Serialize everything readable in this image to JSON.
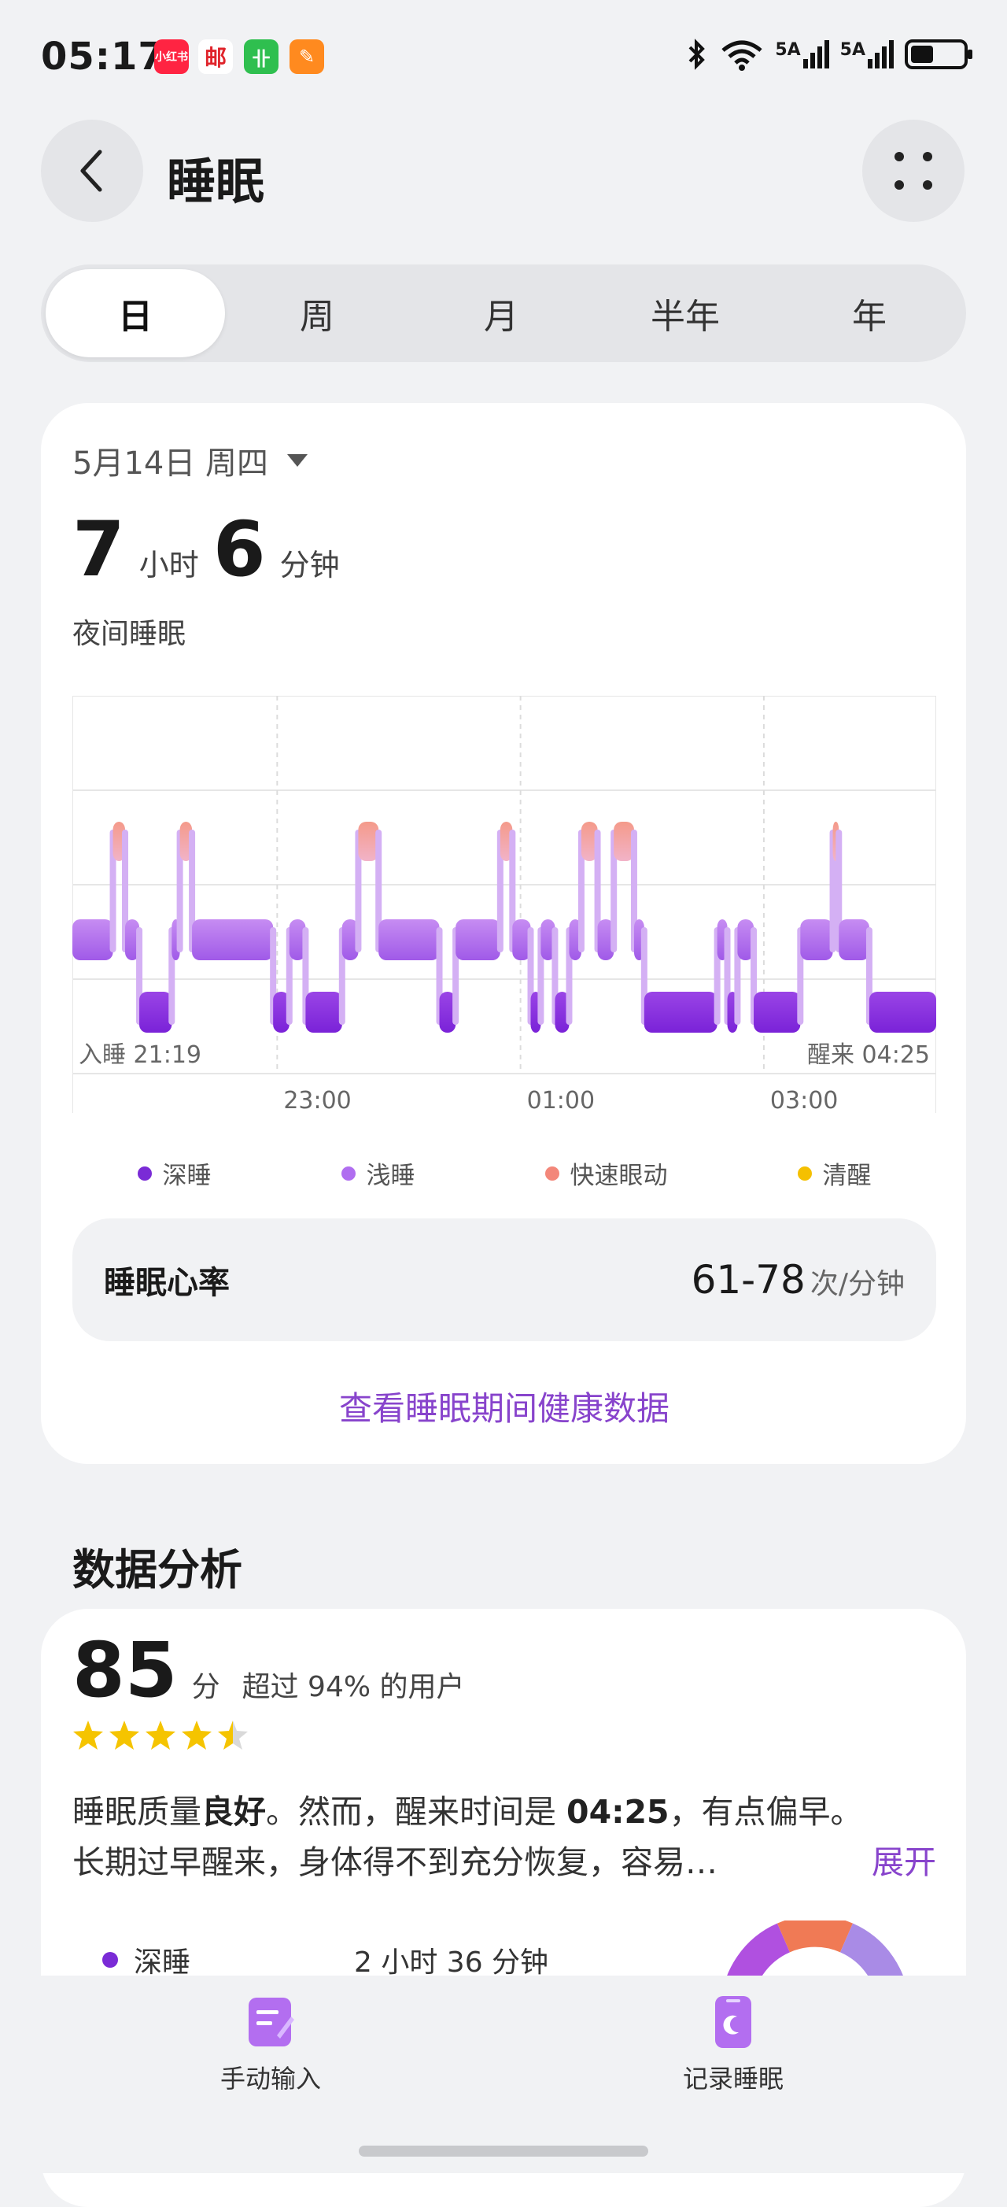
{
  "status": {
    "time": "05:17",
    "apps": [
      {
        "name": "xiaohongshu-icon",
        "label": "小红书",
        "color": "#ff2442"
      },
      {
        "name": "post-icon",
        "label": "邮",
        "color": "#ffffff"
      },
      {
        "name": "green-app-icon",
        "label": "卝",
        "color": "#2fbf4f"
      },
      {
        "name": "orange-app-icon",
        "label": "✎",
        "color": "#ff8a1f"
      }
    ],
    "net1": "5A",
    "net2": "5A"
  },
  "header": {
    "title": "睡眠"
  },
  "tabs": [
    {
      "label": "日"
    },
    {
      "label": "周"
    },
    {
      "label": "月"
    },
    {
      "label": "半年"
    },
    {
      "label": "年"
    }
  ],
  "summary": {
    "date": "5月14日 周四",
    "hours": "7",
    "hours_unit": "小时",
    "minutes": "6",
    "minutes_unit": "分钟",
    "subtitle": "夜间睡眠"
  },
  "chart_data": {
    "type": "area",
    "sleep_start_label": "入睡 21:19",
    "wake_label": "醒来 04:25",
    "x_ticks": [
      "23:00",
      "01:00",
      "03:00"
    ],
    "stages": [
      "深睡",
      "浅睡",
      "快速眼动",
      "清醒"
    ],
    "colors": {
      "deep": "#8a2be2",
      "light": "#b06ef0",
      "rem": "#f3877a",
      "awake": "#f5c000"
    },
    "segments": [
      {
        "start": "21:19",
        "end": "21:39",
        "stage": "light"
      },
      {
        "start": "21:39",
        "end": "21:45",
        "stage": "rem"
      },
      {
        "start": "21:45",
        "end": "21:52",
        "stage": "light"
      },
      {
        "start": "21:52",
        "end": "22:08",
        "stage": "deep"
      },
      {
        "start": "22:08",
        "end": "22:12",
        "stage": "light"
      },
      {
        "start": "22:12",
        "end": "22:18",
        "stage": "rem"
      },
      {
        "start": "22:18",
        "end": "22:58",
        "stage": "light"
      },
      {
        "start": "22:58",
        "end": "23:06",
        "stage": "deep"
      },
      {
        "start": "23:06",
        "end": "23:14",
        "stage": "light"
      },
      {
        "start": "23:14",
        "end": "23:32",
        "stage": "deep"
      },
      {
        "start": "23:32",
        "end": "23:40",
        "stage": "light"
      },
      {
        "start": "23:40",
        "end": "23:50",
        "stage": "rem"
      },
      {
        "start": "23:50",
        "end": "00:20",
        "stage": "light"
      },
      {
        "start": "00:20",
        "end": "00:28",
        "stage": "deep"
      },
      {
        "start": "00:28",
        "end": "00:50",
        "stage": "light"
      },
      {
        "start": "00:50",
        "end": "00:56",
        "stage": "rem"
      },
      {
        "start": "00:56",
        "end": "01:05",
        "stage": "light"
      },
      {
        "start": "01:05",
        "end": "01:10",
        "stage": "deep"
      },
      {
        "start": "01:10",
        "end": "01:17",
        "stage": "light"
      },
      {
        "start": "01:17",
        "end": "01:24",
        "stage": "deep"
      },
      {
        "start": "01:24",
        "end": "01:30",
        "stage": "light"
      },
      {
        "start": "01:30",
        "end": "01:38",
        "stage": "rem"
      },
      {
        "start": "01:38",
        "end": "01:46",
        "stage": "light"
      },
      {
        "start": "01:46",
        "end": "01:56",
        "stage": "rem"
      },
      {
        "start": "01:56",
        "end": "02:01",
        "stage": "light"
      },
      {
        "start": "02:01",
        "end": "02:37",
        "stage": "deep"
      },
      {
        "start": "02:37",
        "end": "02:42",
        "stage": "light"
      },
      {
        "start": "02:42",
        "end": "02:47",
        "stage": "deep"
      },
      {
        "start": "02:47",
        "end": "02:55",
        "stage": "light"
      },
      {
        "start": "02:55",
        "end": "03:18",
        "stage": "deep"
      },
      {
        "start": "03:18",
        "end": "03:34",
        "stage": "light"
      },
      {
        "start": "03:34",
        "end": "03:37",
        "stage": "rem"
      },
      {
        "start": "03:37",
        "end": "03:52",
        "stage": "light"
      },
      {
        "start": "03:52",
        "end": "04:25",
        "stage": "deep"
      }
    ]
  },
  "legend": [
    {
      "label": "深睡",
      "color": "#7a2bd6"
    },
    {
      "label": "浅睡",
      "color": "#b06ef0"
    },
    {
      "label": "快速眼动",
      "color": "#f3877a"
    },
    {
      "label": "清醒",
      "color": "#f5c000"
    }
  ],
  "heart_rate": {
    "label": "睡眠心率",
    "value": "61-78",
    "unit": "次/分钟"
  },
  "health_link": "查看睡眠期间健康数据",
  "analysis": {
    "section_title": "数据分析",
    "score": "85",
    "score_unit": "分",
    "rank": "超过 94% 的用户",
    "stars": 4.5,
    "t1": "睡眠质量",
    "t2": "良好",
    "t3": "。然而，醒来时间是",
    "t4": "04:25",
    "t5": "，有点偏早。",
    "t6": "长期过早醒来，身体得不到充分恢复，容易…",
    "expand": "展开",
    "deep_label": "深睡",
    "deep_value": "2 小时 36 分钟"
  },
  "bottom_nav": [
    {
      "label": "手动输入"
    },
    {
      "label": "记录睡眠"
    }
  ]
}
